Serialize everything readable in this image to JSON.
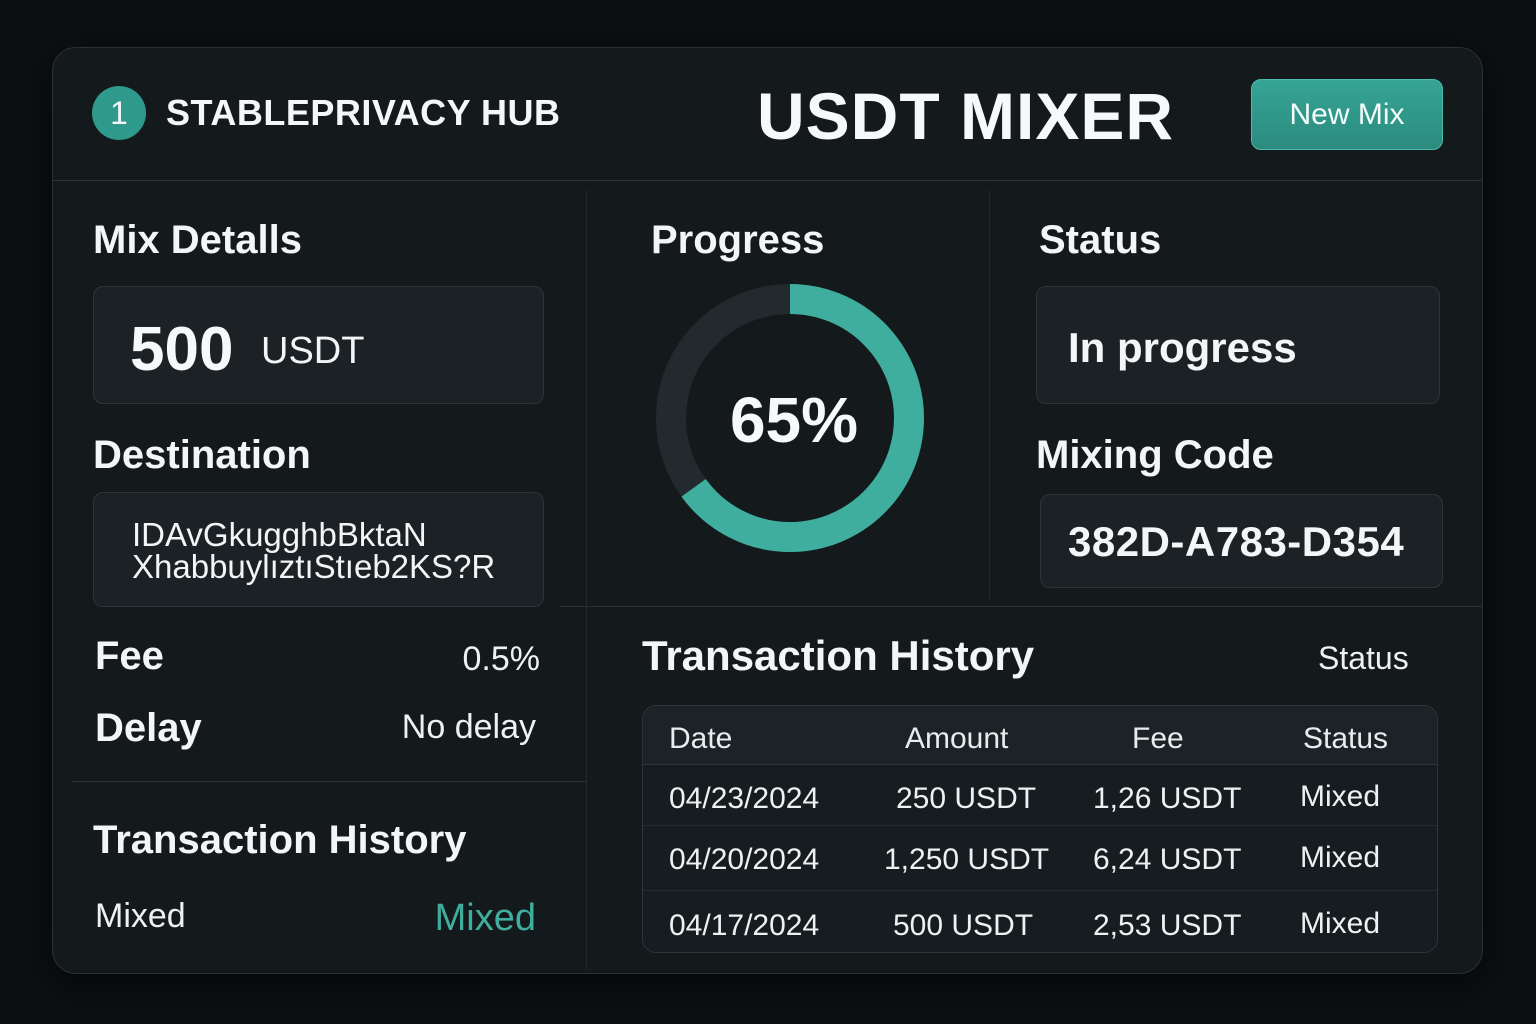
{
  "header": {
    "logo_number": "1",
    "brand": "STABLEPRIVACY HUB",
    "title": "USDT MIXER",
    "new_mix_label": "New Mix"
  },
  "mix_details": {
    "heading": "Mix Detalls",
    "amount": "500",
    "unit": "USDT",
    "destination_heading": "Destination",
    "destination_line1": "IDAvGkugghbBktaN",
    "destination_line2": "XhabbuylıztıStıeb2KS?R",
    "fee_label": "Fee",
    "fee_value": "0.5%",
    "delay_label": "Delay",
    "delay_value": "No delay",
    "history_heading": "Transaction History",
    "history_label": "Mixed",
    "history_value": "Mixed"
  },
  "progress": {
    "heading": "Progress",
    "label": "65%",
    "fraction": 0.65
  },
  "status": {
    "heading": "Status",
    "value": "In progress",
    "code_heading": "Mixing Code",
    "code": "382D-A783-D354"
  },
  "transactions": {
    "heading": "Transaction History",
    "status_label": "Status",
    "columns": [
      "Date",
      "Amount",
      "Fee",
      "Status"
    ],
    "rows": [
      {
        "date": "04/23/2024",
        "amount": "250 USDT",
        "fee": "1,26 USDT",
        "status": "Mixed"
      },
      {
        "date": "04/20/2024",
        "amount": "1,250 USDT",
        "fee": "6,24 USDT",
        "status": "Mixed"
      },
      {
        "date": "04/17/2024",
        "amount": "500 USDT",
        "fee": "2,53 USDT",
        "status": "Mixed"
      }
    ]
  },
  "colors": {
    "accent": "#3fae9e",
    "background": "#0c1013",
    "panel": "#14191c",
    "ring_track": "#232a2e"
  }
}
